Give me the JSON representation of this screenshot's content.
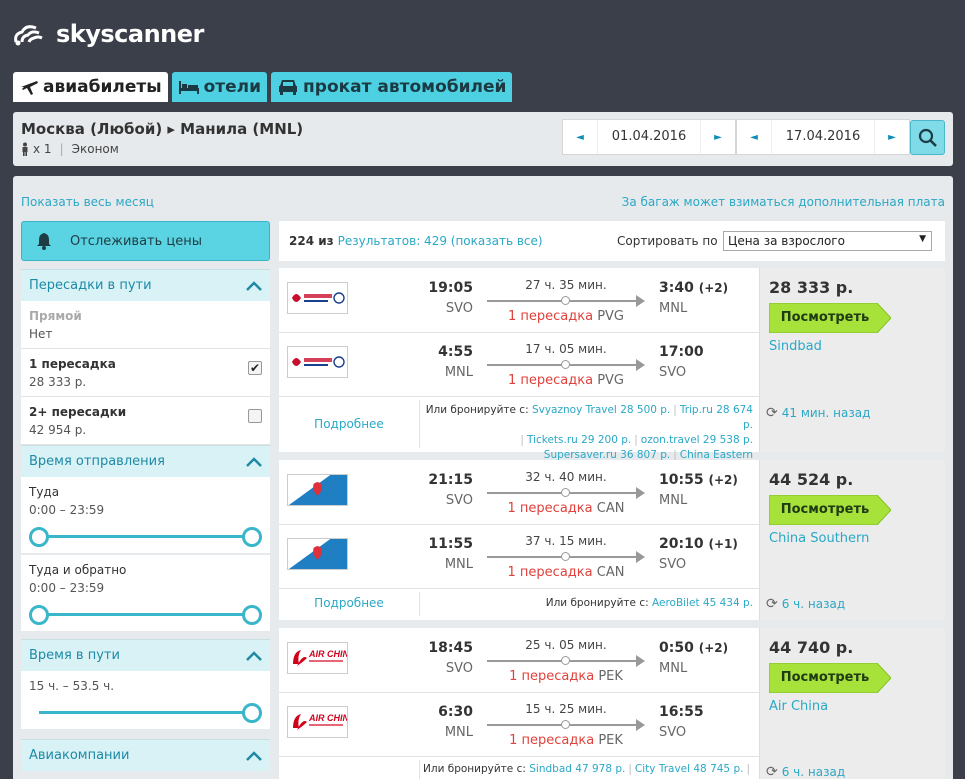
{
  "brand": {
    "name": "skyscanner"
  },
  "tabs": [
    {
      "label": "авиабилеты",
      "icon": "airplane-icon",
      "active": true
    },
    {
      "label": "отели",
      "icon": "bed-icon",
      "active": false
    },
    {
      "label": "прокат автомобилей",
      "icon": "car-icon",
      "active": false
    }
  ],
  "search": {
    "route": "Москва (Любой) ▸ Манила (MNL)",
    "passengers": "x 1",
    "cabin": "Эконом",
    "depart_date": "01.04.2016",
    "return_date": "17.04.2016",
    "prev_arrow": "◄",
    "next_arrow": "►"
  },
  "links": {
    "month": "Показать весь месяц",
    "baggage": "За багаж может взиматься дополнительная плата"
  },
  "sidebar": {
    "track_label": "Отслеживать цены",
    "stops": {
      "title": "Пересадки в пути",
      "options": [
        {
          "label": "Прямой",
          "value": "Нет",
          "checked": false,
          "disabled": true
        },
        {
          "label": "1 пересадка",
          "value": "28 333 р.",
          "checked": true,
          "disabled": false
        },
        {
          "label": "2+ пересадки",
          "value": "42 954 р.",
          "checked": false,
          "disabled": false
        }
      ]
    },
    "departure": {
      "title": "Время отправления",
      "outbound_label": "Туда",
      "outbound_range": "0:00 – 23:59",
      "return_label": "Туда и обратно",
      "return_range": "0:00 – 23:59"
    },
    "duration": {
      "title": "Время в пути",
      "range": "15 ч. – 53.5 ч."
    },
    "airlines": {
      "title": "Авиакомпании"
    }
  },
  "results": {
    "count_shown": "224 из",
    "count_link": "Результатов: 429 (показать все)",
    "sort_label": "Сортировать по",
    "sort_value": "Цена за взрослого"
  },
  "cards": [
    {
      "price": "28 333 р.",
      "button": "Посмотреть",
      "agent": "Sindbad",
      "updated": "41 мин. назад",
      "details": "Подробнее",
      "legs": [
        {
          "airline": "china-eastern",
          "dep_time": "19:05",
          "dep_airport": "SVO",
          "duration": "27 ч. 35 мин.",
          "stops": "1 пересадка",
          "via": "PVG",
          "arr_time": "3:40",
          "arr_plus": "(+2)",
          "arr_airport": "MNL"
        },
        {
          "airline": "china-eastern",
          "dep_time": "4:55",
          "dep_airport": "MNL",
          "duration": "17 ч. 05 мин.",
          "stops": "1 пересадка",
          "via": "PVG",
          "arr_time": "17:00",
          "arr_plus": "",
          "arr_airport": "SVO"
        }
      ],
      "alts_prefix": "Или бронируйте с:",
      "alts": [
        "Svyaznoy Travel 28 500 р.",
        "Trip.ru 28 674 р.",
        "Tickets.ru 29 200 р.",
        "ozon.travel 29 538 р.",
        "Supersaver.ru 36 807 р.",
        "China Eastern"
      ]
    },
    {
      "price": "44 524 р.",
      "button": "Посмотреть",
      "agent": "China Southern",
      "updated": "6 ч. назад",
      "details": "Подробнее",
      "legs": [
        {
          "airline": "china-southern",
          "dep_time": "21:15",
          "dep_airport": "SVO",
          "duration": "32 ч. 40 мин.",
          "stops": "1 пересадка",
          "via": "CAN",
          "arr_time": "10:55",
          "arr_plus": "(+2)",
          "arr_airport": "MNL"
        },
        {
          "airline": "china-southern",
          "dep_time": "11:55",
          "dep_airport": "MNL",
          "duration": "37 ч. 15 мин.",
          "stops": "1 пересадка",
          "via": "CAN",
          "arr_time": "20:10",
          "arr_plus": "(+1)",
          "arr_airport": "SVO"
        }
      ],
      "alts_prefix": "Или бронируйте с:",
      "alts": [
        "AeroBilet 45 434 р."
      ]
    },
    {
      "price": "44 740 р.",
      "button": "Посмотреть",
      "agent": "Air China",
      "updated": "6 ч. назад",
      "legs": [
        {
          "airline": "air-china",
          "dep_time": "18:45",
          "dep_airport": "SVO",
          "duration": "25 ч. 05 мин.",
          "stops": "1 пересадка",
          "via": "PEK",
          "arr_time": "0:50",
          "arr_plus": "(+2)",
          "arr_airport": "MNL"
        },
        {
          "airline": "air-china",
          "dep_time": "6:30",
          "dep_airport": "MNL",
          "duration": "15 ч. 25 мин.",
          "stops": "1 пересадка",
          "via": "PEK",
          "arr_time": "16:55",
          "arr_plus": "",
          "arr_airport": "SVO"
        }
      ],
      "alts_prefix": "Или бронируйте с:",
      "alts": [
        "Sindbad 47 978 р.",
        "City Travel 48 745 р."
      ]
    }
  ],
  "colors": {
    "accent": "#2aa8c6",
    "stop_red": "#e0413b",
    "header": "#3a3f4a",
    "button_green": "#a6e23a"
  }
}
